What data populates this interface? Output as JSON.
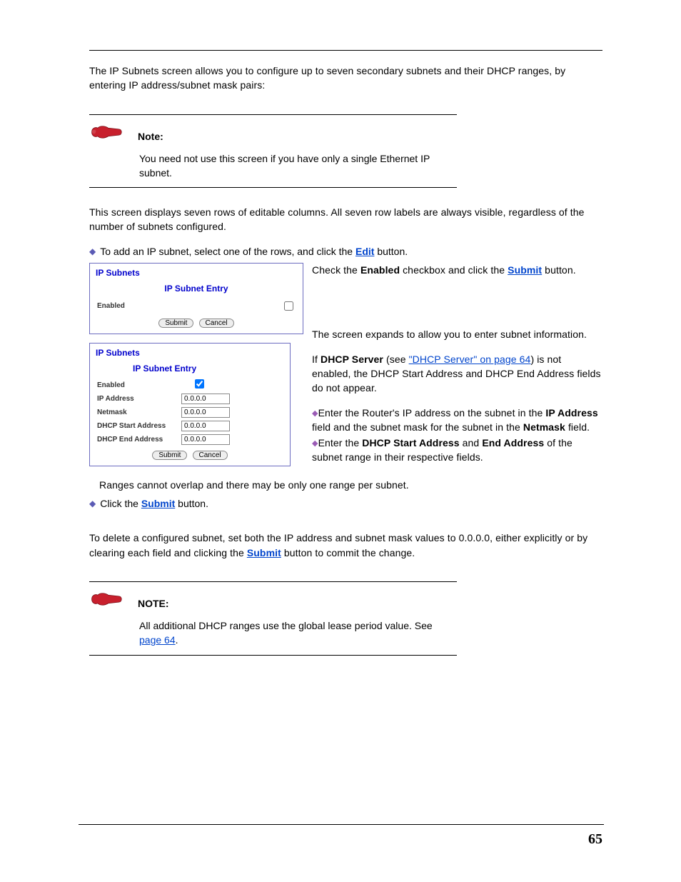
{
  "intro": "The IP Subnets screen allows you to configure up to seven secondary subnets and their DHCP ranges, by entering IP address/subnet mask pairs:",
  "note1": {
    "label": "Note:",
    "body": "You need not use this screen if you have only a single Ethernet IP subnet."
  },
  "para2": "This screen displays seven rows of editable columns. All seven row labels are always visible, regardless of the number of subnets configured.",
  "bullet_add_pre": "To add an IP subnet, select one of the rows, and click the ",
  "bullet_add_link": "Edit",
  "bullet_add_post": " button.",
  "right1_pre": "Check the ",
  "right1_bold": "Enabled",
  "right1_mid": " checkbox and click the ",
  "right1_link": "Submit",
  "right1_post": " button.",
  "right2_a": "The screen expands to allow you to enter subnet information.",
  "right2_b_pre": "If ",
  "right2_b_bold": "DHCP Server",
  "right2_b_mid": " (see ",
  "right2_b_link": "\"DHCP Server\" on page 64",
  "right2_b_post": ") is not enabled, the DHCP Start Address and DHCP End Address fields do not appear.",
  "right2_c_pre": "Enter the Router's IP address on the subnet in the ",
  "right2_c_bold1": "IP Address",
  "right2_c_mid": " field and the subnet mask for the subnet in the ",
  "right2_c_bold2": "Netmask",
  "right2_c_post": " field.",
  "right2_d_pre": "Enter the ",
  "right2_d_bold1": "DHCP Start Address",
  "right2_d_mid": " and ",
  "right2_d_bold2": "End Address",
  "right2_d_post": " of the subnet range in their respective fields.",
  "para_ranges": "Ranges cannot overlap and there may be only one range per subnet.",
  "bullet_submit_pre": "Click the ",
  "bullet_submit_link": "Submit",
  "bullet_submit_post": " button.",
  "para_delete_pre": "To delete a configured subnet, set both the IP address and subnet mask values to 0.0.0.0, either explicitly or by clearing each field and clicking the ",
  "para_delete_link": "Submit",
  "para_delete_post": " button to commit the change.",
  "note2": {
    "label": "NOTE:",
    "body_pre": "All additional DHCP ranges use the global lease period value. See ",
    "body_link": "page 64",
    "body_post": "."
  },
  "panel": {
    "title": "IP Subnets",
    "subtitle": "IP Subnet Entry",
    "enabled": "Enabled",
    "ip": "IP Address",
    "netmask": "Netmask",
    "dhcp_start": "DHCP Start Address",
    "dhcp_end": "DHCP End Address",
    "zero": "0.0.0.0",
    "submit": "Submit",
    "cancel": "Cancel"
  },
  "page_number": "65"
}
